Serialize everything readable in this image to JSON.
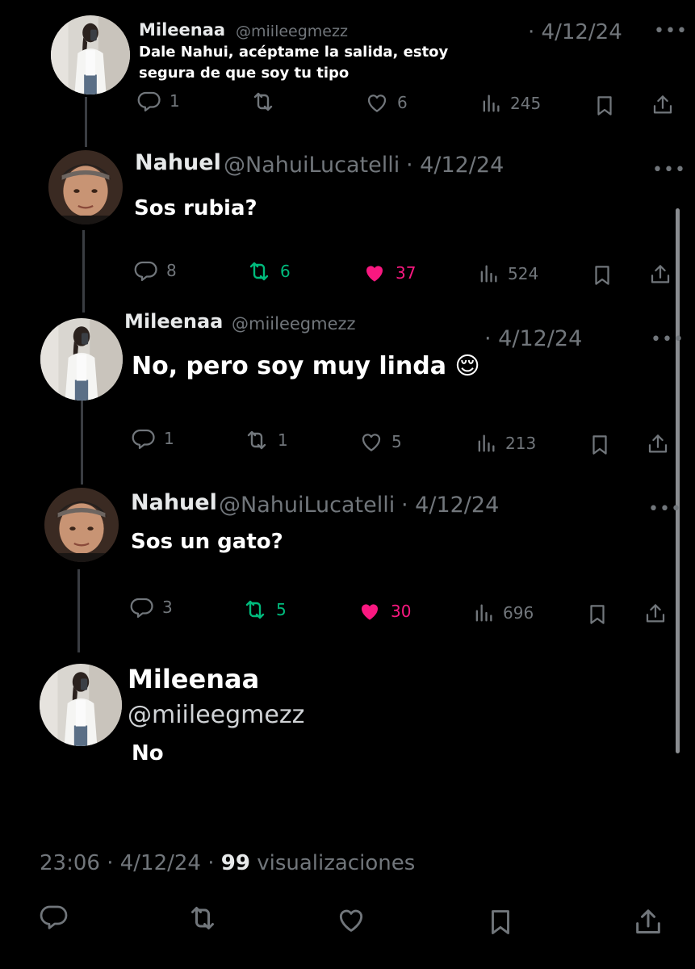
{
  "colors": {
    "background": "#000000",
    "muted": "#71767b",
    "like_active": "#f91880",
    "retweet_active": "#00ba7c",
    "text": "#e7e9ea"
  },
  "tweets": [
    {
      "name": "Mileenaa",
      "handle": "@miileegmezz",
      "date": "· 4/12/24",
      "text_lines": [
        "Dale Nahui, acéptame la salida, estoy",
        "segura de que soy tu tipo"
      ],
      "stats": {
        "replies": "1",
        "retweets": "",
        "likes": "6",
        "views": "245"
      },
      "liked": false,
      "retweeted": false
    },
    {
      "name": "Nahuel",
      "handle": "@NahuiLucatelli",
      "date": "· 4/12/24",
      "text": "Sos rubia?",
      "stats": {
        "replies": "8",
        "retweets": "6",
        "likes": "37",
        "views": "524"
      },
      "liked": true,
      "retweeted": true
    },
    {
      "name": "Mileenaa",
      "handle": "@miileegmezz",
      "date": "· 4/12/24",
      "text": "No, pero soy muy linda 😌",
      "stats": {
        "replies": "1",
        "retweets": "1",
        "likes": "5",
        "views": "213"
      },
      "liked": false,
      "retweeted": false
    },
    {
      "name": "Nahuel",
      "handle": "@NahuiLucatelli",
      "date": "· 4/12/24",
      "text": "Sos un gato?",
      "stats": {
        "replies": "3",
        "retweets": "5",
        "likes": "30",
        "views": "696"
      },
      "liked": true,
      "retweeted": true
    }
  ],
  "main_tweet": {
    "name": "Mileenaa",
    "handle": "@miileegmezz",
    "text": "No",
    "time": "23:06 · 4/12/24 · ",
    "views_count": "99",
    "views_label": "visualizaciones"
  },
  "icons": [
    "reply-icon",
    "retweet-icon",
    "like-icon",
    "views-icon",
    "bookmark-icon",
    "share-icon",
    "more-icon"
  ]
}
